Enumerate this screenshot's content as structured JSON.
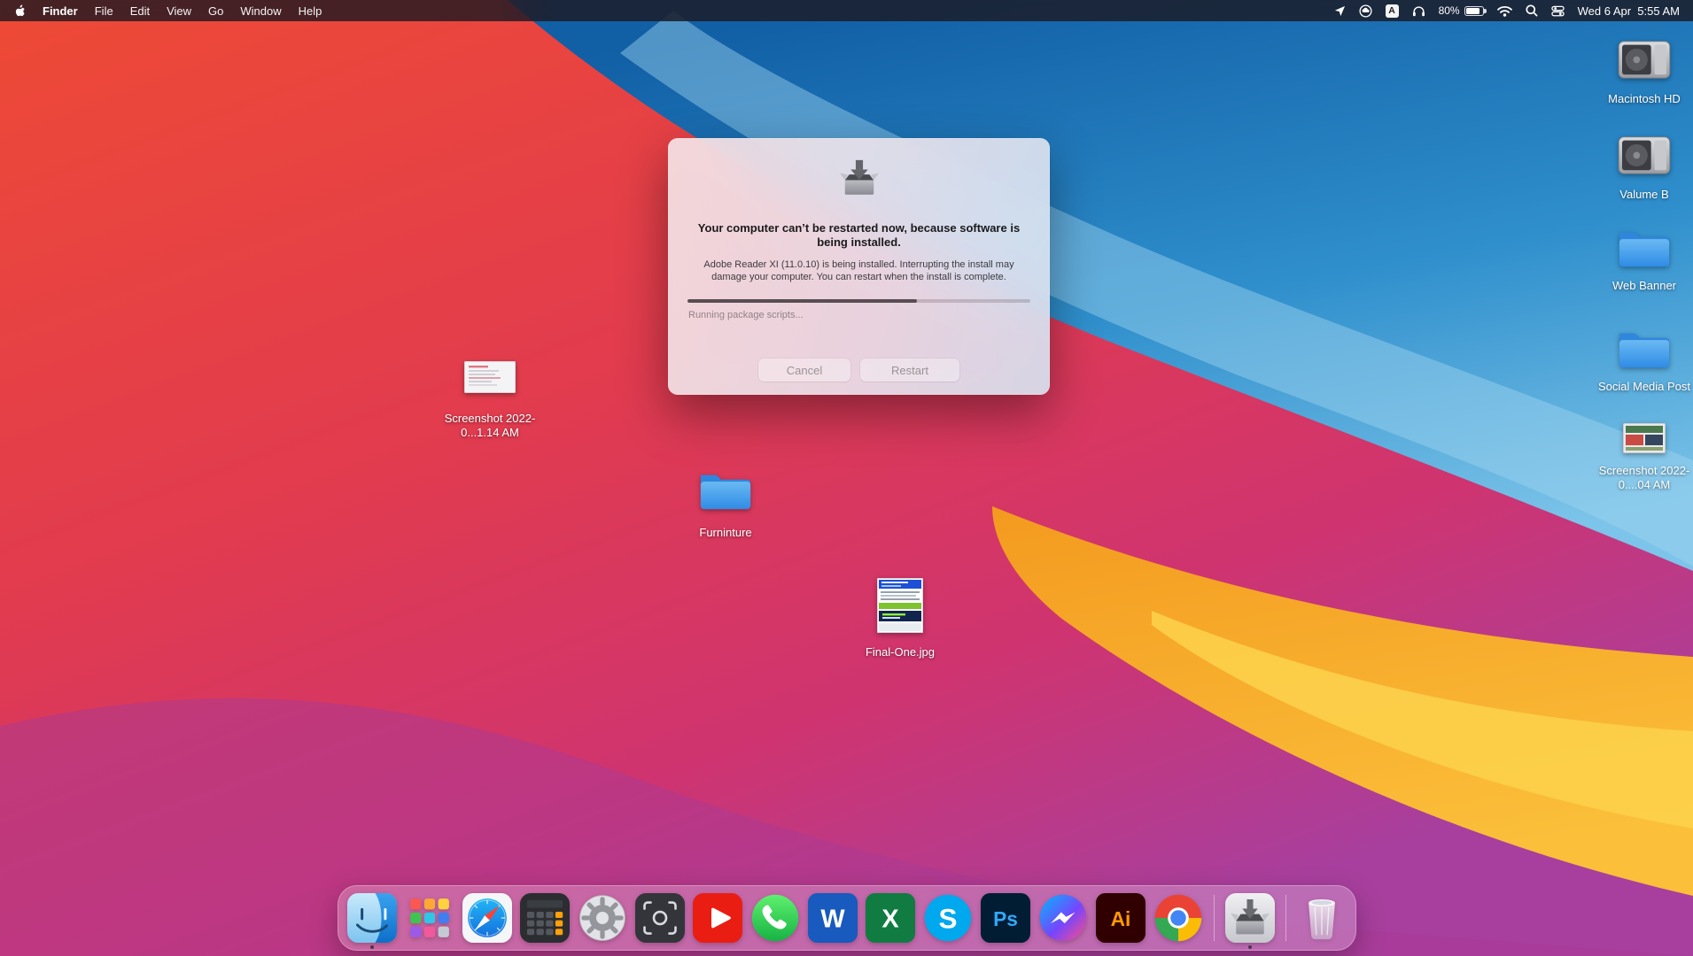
{
  "menu_bar": {
    "app_name": "Finder",
    "menus": [
      "File",
      "Edit",
      "View",
      "Go",
      "Window",
      "Help"
    ],
    "input_source": "A",
    "battery_percent": "80%",
    "clock": "Wed 6 Apr  5:55 AM",
    "status_icons": [
      "location-icon",
      "adobe-cc-icon",
      "input-source-icon",
      "headphones-icon",
      "battery-icon",
      "wifi-icon",
      "spotlight-icon",
      "control-center-icon"
    ]
  },
  "dialog": {
    "title": "Your computer can’t be restarted now, because software is being installed.",
    "body": "Adobe Reader XI (11.0.10) is being installed. Interrupting the install may damage your computer. You can restart when the install is complete.",
    "status": "Running package scripts...",
    "progress_percent": 67,
    "buttons": {
      "cancel": "Cancel",
      "restart": "Restart"
    }
  },
  "desktop": {
    "icons": [
      {
        "label": "Macintosh HD",
        "type": "internal-drive"
      },
      {
        "label": "Valume B",
        "type": "internal-drive"
      },
      {
        "label": "Web Banner",
        "type": "folder"
      },
      {
        "label": "Social Media Post",
        "type": "folder"
      },
      {
        "label": "Screenshot 2022-0....04 AM",
        "type": "image-file"
      },
      {
        "label": "Screenshot 2022-0...1.14 AM",
        "type": "image-file"
      },
      {
        "label": "Furninture",
        "type": "folder"
      },
      {
        "label": "Final-One.jpg",
        "type": "image-file"
      }
    ]
  },
  "dock": {
    "items": [
      "Finder",
      "Launchpad",
      "Safari",
      "Calculator",
      "System Preferences",
      "Screenshot",
      "YouTube",
      "WhatsApp",
      "Word",
      "Excel",
      "Skype",
      "Photoshop",
      "Messenger",
      "Illustrator",
      "Chrome",
      "Installer",
      "Trash"
    ],
    "running": [
      "Finder",
      "Installer"
    ],
    "glyphs": {
      "word": "W",
      "excel": "X",
      "skype": "S",
      "photoshop": "Ps",
      "illustrator": "Ai"
    }
  }
}
